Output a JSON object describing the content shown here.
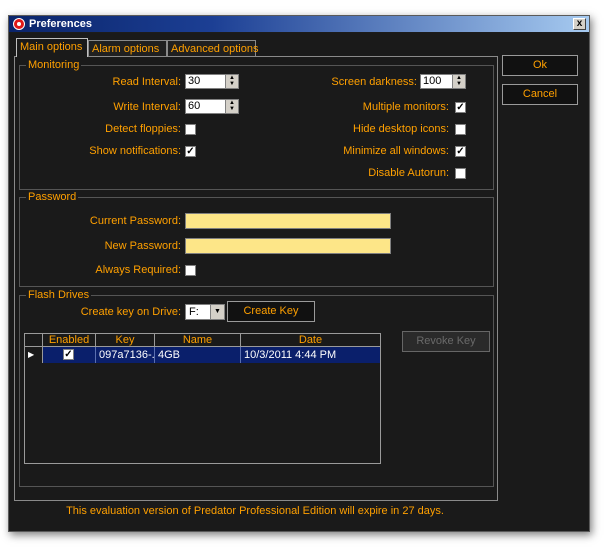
{
  "window": {
    "title": "Preferences",
    "close_label": "x"
  },
  "tabs": [
    {
      "label": "Main options"
    },
    {
      "label": "Alarm options"
    },
    {
      "label": "Advanced options"
    }
  ],
  "monitoring": {
    "title": "Monitoring",
    "read_interval_label": "Read Interval:",
    "read_interval_value": "30",
    "write_interval_label": "Write Interval:",
    "write_interval_value": "60",
    "detect_floppies_label": "Detect floppies:",
    "detect_floppies_checked": false,
    "show_notifications_label": "Show notifications:",
    "show_notifications_checked": true,
    "screen_darkness_label": "Screen darkness:",
    "screen_darkness_value": "100",
    "multiple_monitors_label": "Multiple monitors:",
    "multiple_monitors_checked": true,
    "hide_desktop_icons_label": "Hide desktop icons:",
    "hide_desktop_icons_checked": false,
    "minimize_all_windows_label": "Minimize all windows:",
    "minimize_all_windows_checked": true,
    "disable_autorun_label": "Disable Autorun:",
    "disable_autorun_checked": false
  },
  "password": {
    "title": "Password",
    "current_label": "Current Password:",
    "current_value": "",
    "new_label": "New Password:",
    "new_value": "",
    "always_required_label": "Always Required:",
    "always_required_checked": false
  },
  "flash": {
    "title": "Flash Drives",
    "create_key_on_label": "Create key on Drive:",
    "drive_value": "F:",
    "create_key_button": "Create Key",
    "revoke_key_button": "Revoke Key",
    "columns": [
      "Enabled",
      "Key",
      "Name",
      "Date"
    ],
    "rows": [
      {
        "enabled": true,
        "key": "097a7136-...",
        "name": "4GB",
        "date": "10/3/2011 4:44 PM"
      }
    ]
  },
  "buttons": {
    "ok": "Ok",
    "cancel": "Cancel"
  },
  "footer": "This evaluation version of Predator Professional Edition will expire in 27 days.",
  "colors": {
    "accent": "#ffa000",
    "background": "#1a1a1a",
    "selection": "#0a1f6b",
    "input": "#fde688"
  }
}
